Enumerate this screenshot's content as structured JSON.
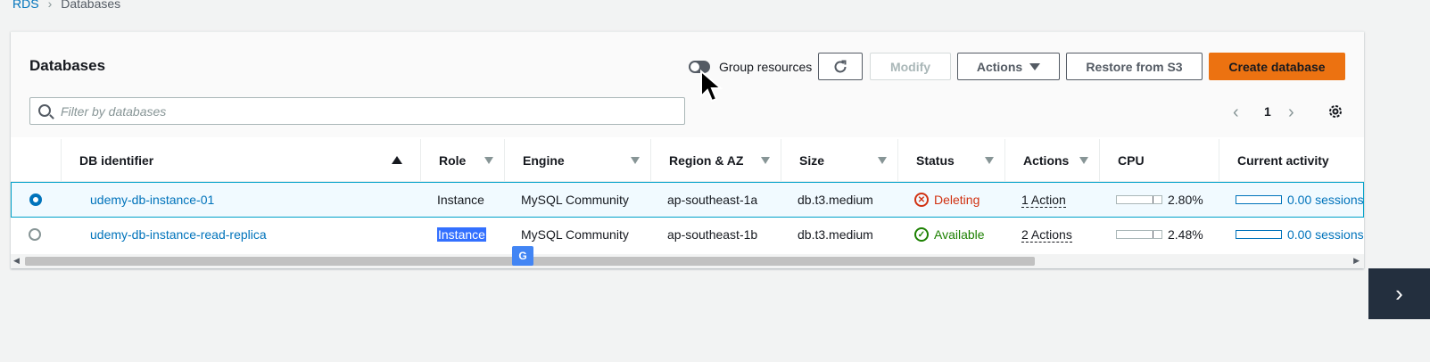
{
  "breadcrumb": {
    "root": "RDS",
    "current": "Databases"
  },
  "panel": {
    "title": "Databases"
  },
  "toolbar": {
    "group_resources": "Group resources",
    "modify": "Modify",
    "actions": "Actions",
    "restore": "Restore from S3",
    "create": "Create database"
  },
  "search": {
    "placeholder": "Filter by databases"
  },
  "pagination": {
    "page": "1"
  },
  "columns": [
    "DB identifier",
    "Role",
    "Engine",
    "Region & AZ",
    "Size",
    "Status",
    "Actions",
    "CPU",
    "Current activity"
  ],
  "rows": [
    {
      "id": "udemy-db-instance-01",
      "role": "Instance",
      "engine": "MySQL Community",
      "region": "ap-southeast-1a",
      "size": "db.t3.medium",
      "status": "Deleting",
      "actions": "1 Action",
      "cpu": "2.80%",
      "activity": "0.00 sessions",
      "selected": true
    },
    {
      "id": "udemy-db-instance-read-replica",
      "role": "Instance",
      "engine": "MySQL Community",
      "region": "ap-southeast-1b",
      "size": "db.t3.medium",
      "status": "Available",
      "actions": "2 Actions",
      "cpu": "2.48%",
      "activity": "0.00 sessions",
      "selected": false
    }
  ],
  "colors": {
    "accent": "#ec7211",
    "link": "#0073bb",
    "deleting": "#d13212",
    "available": "#1d8102"
  },
  "icons": [
    "refresh-icon",
    "caret-down-icon",
    "search-icon",
    "settings-icon",
    "chevron-left-icon",
    "chevron-right-icon",
    "translate-icon",
    "mouse-cursor-icon"
  ]
}
